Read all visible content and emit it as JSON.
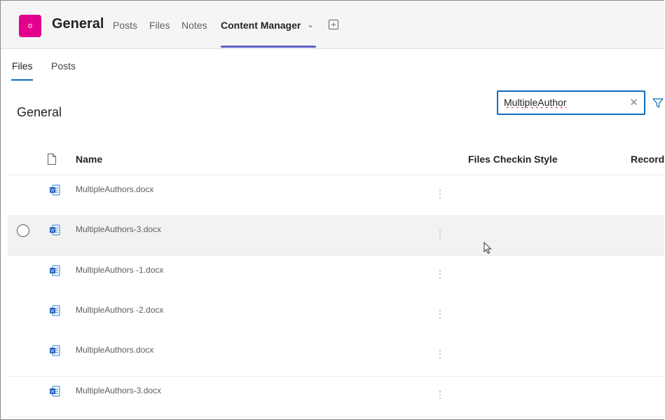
{
  "header": {
    "team_avatar_letter": "o",
    "channel_title": "General",
    "tabs": [
      {
        "label": "Posts"
      },
      {
        "label": "Files"
      },
      {
        "label": "Notes"
      },
      {
        "label": "Content Manager"
      }
    ],
    "active_tab": "Content Manager",
    "accent_color": "#5b5fc7",
    "avatar_color": "#e3008c"
  },
  "subtabs": [
    {
      "label": "Files"
    },
    {
      "label": "Posts"
    }
  ],
  "library": {
    "title": "General"
  },
  "search": {
    "value": "MultipleAuthor",
    "clear_icon": "close-icon"
  },
  "table": {
    "columns": [
      "Name",
      "Files Checkin Style",
      "Record"
    ],
    "rows": [
      {
        "name": "MultipleAuthors.docx",
        "selected": false
      },
      {
        "name": "MultipleAuthors-3.docx",
        "selected": true
      },
      {
        "name": "MultipleAuthors -1.docx",
        "selected": false
      },
      {
        "name": "MultipleAuthors -2.docx",
        "selected": false
      },
      {
        "name": "MultipleAuthors.docx",
        "selected": false
      },
      {
        "name": "MultipleAuthors-3.docx",
        "selected": false
      }
    ]
  }
}
